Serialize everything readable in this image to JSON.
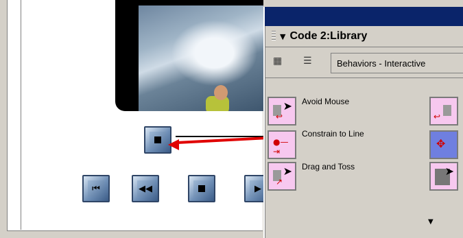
{
  "library_panel": {
    "title": "Code 2:Library",
    "category_select": "Behaviors - Interactive",
    "behaviors": [
      {
        "label": "Avoid Mouse"
      },
      {
        "label": "Constrain to Line"
      },
      {
        "label": "Drag and Toss"
      }
    ]
  },
  "icons": {
    "panel_grip": "grip-icon",
    "expand": "triangle-down-icon",
    "grid_view": "grid-view-icon",
    "list_view": "list-view-icon",
    "play_controls": [
      "rewind-start-icon",
      "rewind-icon",
      "stop-icon",
      "play-icon"
    ]
  },
  "colors": {
    "titlebar": "#0a246a",
    "behavior_icon_bg": "#f7c8ef",
    "arrow": "#e00000",
    "stage_bg": "#ffffff"
  }
}
